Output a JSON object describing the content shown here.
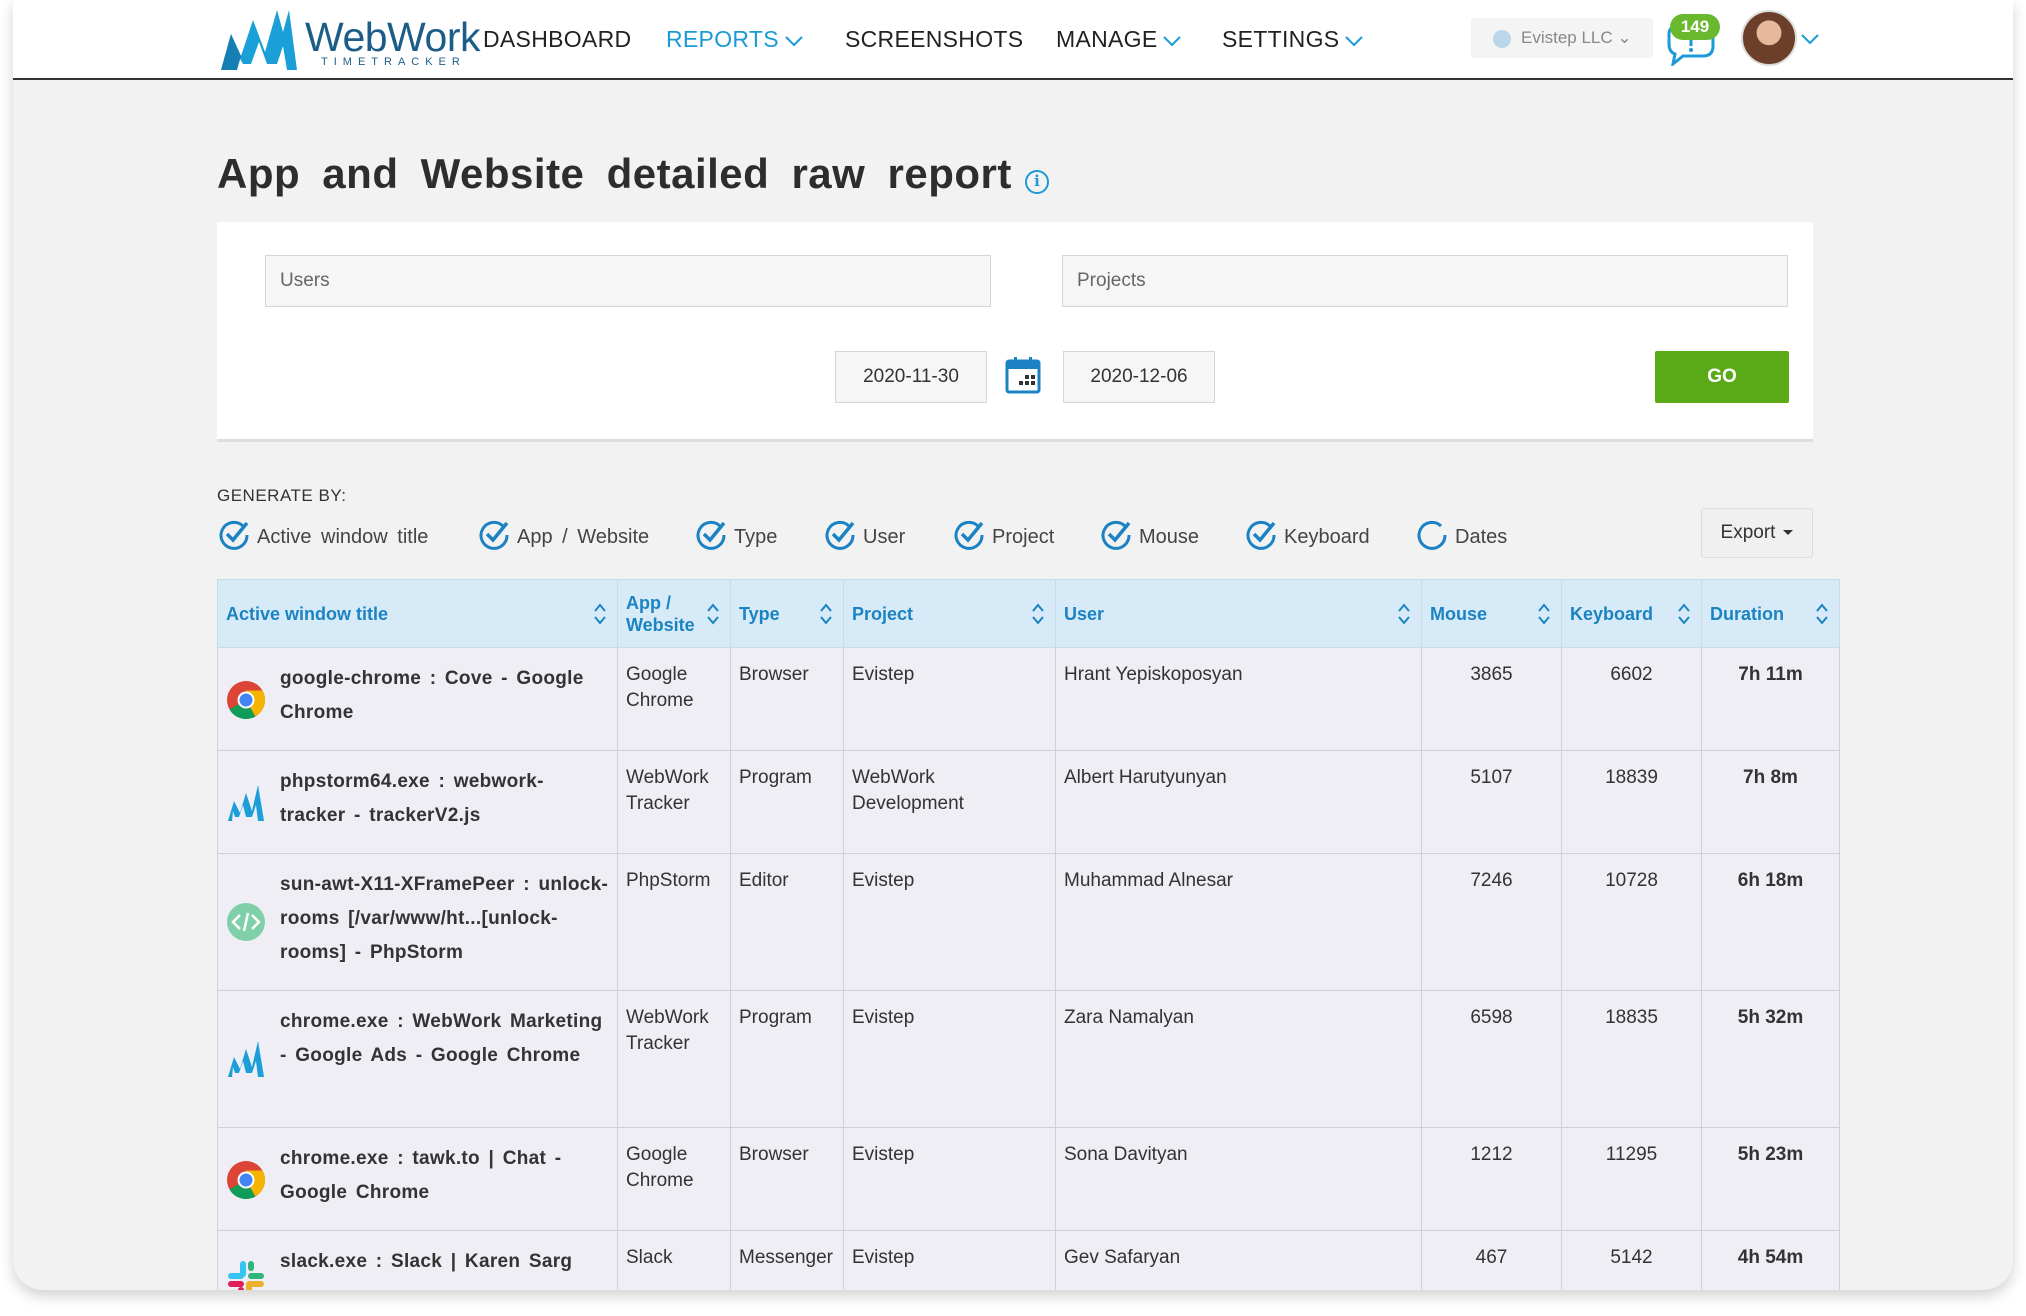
{
  "brand": {
    "name": "WebWork",
    "tagline": "TIMETRACKER"
  },
  "nav": {
    "dashboard": "DASHBOARD",
    "reports": "REPORTS",
    "screenshots": "SCREENSHOTS",
    "manage": "MANAGE",
    "settings": "SETTINGS"
  },
  "org": {
    "name": "Evistep LLC"
  },
  "notifications": {
    "count": "149"
  },
  "page": {
    "title": "App and Website detailed raw report"
  },
  "filters": {
    "users_placeholder": "Users",
    "projects_placeholder": "Projects",
    "date_from": "2020-11-30",
    "date_to": "2020-12-06",
    "go_label": "GO"
  },
  "generate_by": {
    "label": "GENERATE BY:",
    "options": [
      {
        "label": "Active window title",
        "checked": true
      },
      {
        "label": "App / Website",
        "checked": true
      },
      {
        "label": "Type",
        "checked": true
      },
      {
        "label": "User",
        "checked": true
      },
      {
        "label": "Project",
        "checked": true
      },
      {
        "label": "Mouse",
        "checked": true
      },
      {
        "label": "Keyboard",
        "checked": true
      },
      {
        "label": "Dates",
        "checked": false
      }
    ],
    "export_label": "Export"
  },
  "table": {
    "headers": [
      "Active window title",
      "App / Website",
      "Type",
      "Project",
      "User",
      "Mouse",
      "Keyboard",
      "Duration"
    ],
    "rows": [
      {
        "icon": "chrome-icon",
        "title": "google-chrome : Cove - Google Chrome",
        "app": "Google Chrome",
        "type": "Browser",
        "project": "Evistep",
        "user": "Hrant Yepiskoposyan",
        "mouse": "3865",
        "keyboard": "6602",
        "duration": "7h 11m"
      },
      {
        "icon": "webwork-icon",
        "title": "phpstorm64.exe : webwork-tracker - trackerV2.js",
        "app": "WebWork Tracker",
        "type": "Program",
        "project": "WebWork Development",
        "user": "Albert Harutyunyan",
        "mouse": "5107",
        "keyboard": "18839",
        "duration": "7h 8m"
      },
      {
        "icon": "code-icon",
        "title": "sun-awt-X11-XFramePeer : unlock-rooms [/var/www/ht...[unlock-rooms] - PhpStorm",
        "app": "PhpStorm",
        "type": "Editor",
        "project": "Evistep",
        "user": "Muhammad Alnesar",
        "mouse": "7246",
        "keyboard": "10728",
        "duration": "6h 18m"
      },
      {
        "icon": "webwork-icon",
        "title": "chrome.exe : WebWork Marketing - Google Ads - Google Chrome",
        "app": "WebWork Tracker",
        "type": "Program",
        "project": "Evistep",
        "user": "Zara Namalyan",
        "mouse": "6598",
        "keyboard": "18835",
        "duration": "5h 32m"
      },
      {
        "icon": "chrome-icon",
        "title": "chrome.exe : tawk.to | Chat - Google Chrome",
        "app": "Google Chrome",
        "type": "Browser",
        "project": "Evistep",
        "user": "Sona Davityan",
        "mouse": "1212",
        "keyboard": "11295",
        "duration": "5h 23m"
      },
      {
        "icon": "slack-icon",
        "title": "slack.exe : Slack | Karen Sarg",
        "app": "Slack",
        "type": "Messenger",
        "project": "Evistep",
        "user": "Gev Safaryan",
        "mouse": "467",
        "keyboard": "5142",
        "duration": "4h 54m"
      }
    ]
  },
  "colors": {
    "accent": "#1b9ad6",
    "go_button": "#5aa916",
    "header_bg": "#d6ebf7",
    "header_text": "#1c83c3",
    "badge": "#6ab82e"
  }
}
